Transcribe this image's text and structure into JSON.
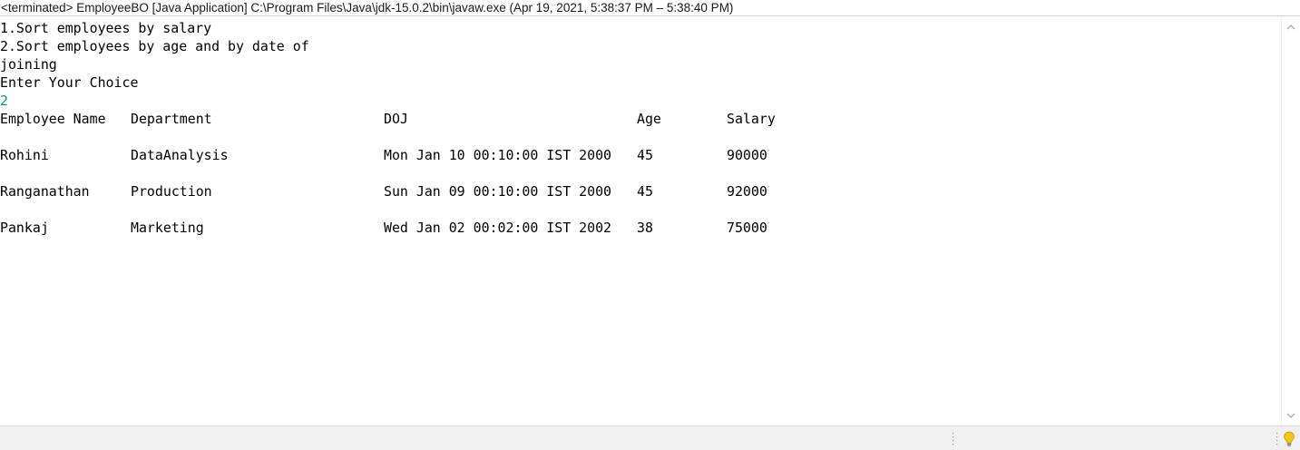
{
  "title_bar": {
    "text": "<terminated> EmployeeBO [Java Application] C:\\Program Files\\Java\\jdk-15.0.2\\bin\\javaw.exe  (Apr 19, 2021, 5:38:37 PM – 5:38:40 PM)"
  },
  "console": {
    "menu_lines": [
      "1.Sort employees by salary",
      "2.Sort employees by age and by date of",
      "joining",
      "Enter Your Choice"
    ],
    "user_input": "2",
    "table": {
      "headers": [
        "Employee Name",
        "Department",
        "DOJ",
        "Age",
        "Salary"
      ],
      "rows": [
        [
          "Rohini",
          "DataAnalysis",
          "Mon Jan 10 00:10:00 IST 2000",
          "45",
          "90000"
        ],
        [
          "Ranganathan",
          "Production",
          "Sun Jan 09 00:10:00 IST 2000",
          "45",
          "92000"
        ],
        [
          "Pankaj",
          "Marketing",
          "Wed Jan 02 00:02:00 IST 2002",
          "38",
          "75000"
        ]
      ]
    }
  },
  "colors": {
    "input_text": "#00a070",
    "status_bar_bg": "#f0f0f0",
    "bulb": "#f5c518"
  },
  "icons": {
    "scroll_up": "chevron-up-icon",
    "scroll_down": "chevron-down-icon",
    "status_bulb": "lightbulb-icon"
  }
}
